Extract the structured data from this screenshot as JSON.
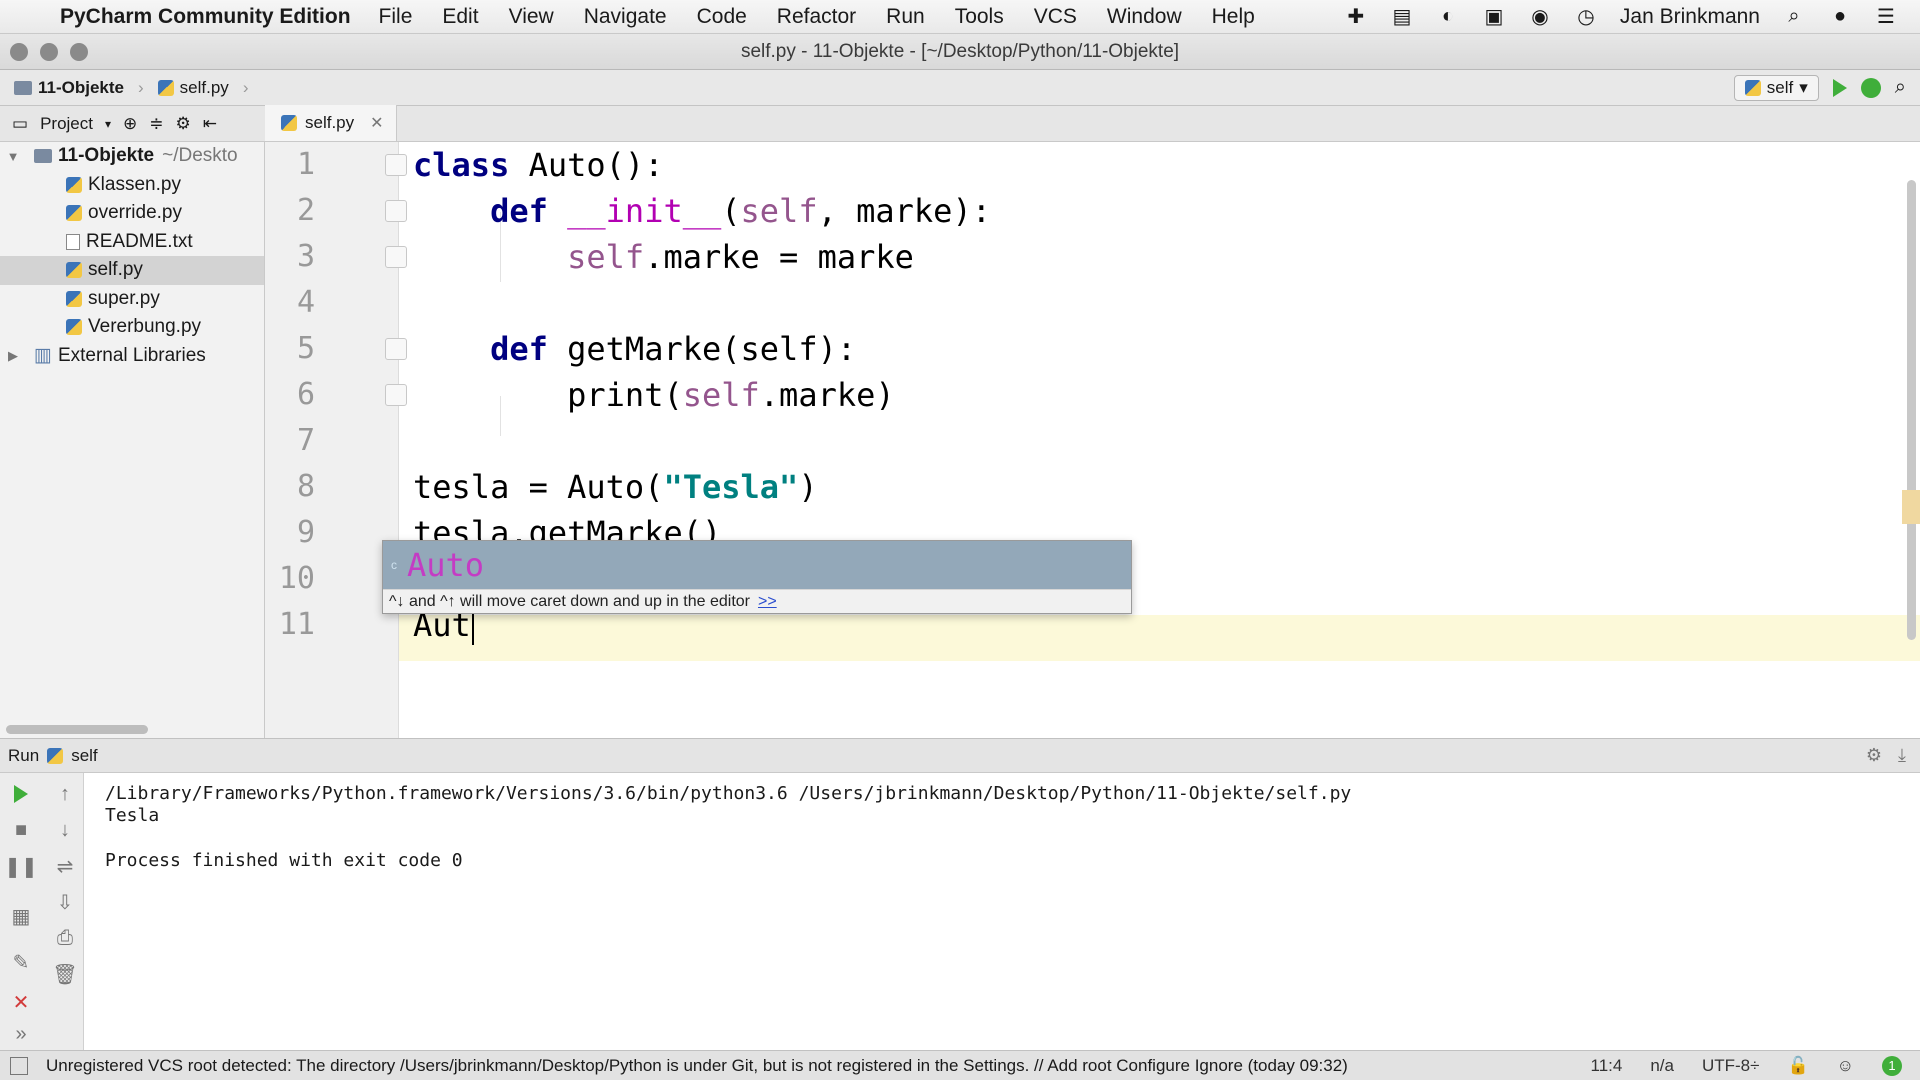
{
  "menubar": {
    "app_name": "PyCharm Community Edition",
    "items": [
      "File",
      "Edit",
      "View",
      "Navigate",
      "Code",
      "Refactor",
      "Run",
      "Tools",
      "VCS",
      "Window",
      "Help"
    ],
    "user": "Jan Brinkmann"
  },
  "window": {
    "title": "self.py - 11-Objekte - [~/Desktop/Python/11-Objekte]"
  },
  "navbar": {
    "crumb_project": "11-Objekte",
    "crumb_file": "self.py",
    "run_config": "self"
  },
  "project_panel": {
    "label": "Project",
    "root": "11-Objekte",
    "root_path": "~/Deskto",
    "files": [
      {
        "name": "Klassen.py",
        "type": "py"
      },
      {
        "name": "override.py",
        "type": "py"
      },
      {
        "name": "README.txt",
        "type": "txt"
      },
      {
        "name": "self.py",
        "type": "py",
        "selected": true
      },
      {
        "name": "super.py",
        "type": "py"
      },
      {
        "name": "Vererbung.py",
        "type": "py"
      }
    ],
    "external": "External Libraries"
  },
  "editor": {
    "tab_label": "self.py",
    "line_numbers": [
      "1",
      "2",
      "3",
      "4",
      "5",
      "6",
      "7",
      "8",
      "9",
      "10",
      "11"
    ],
    "tokens": {
      "l1_kw": "class",
      "l1_rest": " Auto():",
      "l2_kw": "def",
      "l2_magic": "__init__",
      "l2_open": "(",
      "l2_self": "self",
      "l2_rest": ", marke):",
      "l3_self": "self",
      "l3_rest": ".marke = marke",
      "l5_kw": "def",
      "l5_rest": " getMarke(self):",
      "l6_a": "print(",
      "l6_self": "self",
      "l6_b": ".marke)",
      "l8_a": "tesla = Auto(",
      "l8_str": "\"Tesla\"",
      "l8_b": ")",
      "l9": "tesla.getMarke()",
      "l11": "Aut"
    }
  },
  "completion": {
    "kind_icon": "c",
    "item": "Auto",
    "hint": "^↓ and ^↑ will move caret down and up in the editor",
    "hint_link": ">>"
  },
  "run_panel": {
    "label": "Run",
    "config": "self",
    "output": [
      "/Library/Frameworks/Python.framework/Versions/3.6/bin/python3.6 /Users/jbrinkmann/Desktop/Python/11-Objekte/self.py",
      "Tesla",
      "",
      "Process finished with exit code 0"
    ]
  },
  "statusbar": {
    "message": "Unregistered VCS root detected: The directory /Users/jbrinkmann/Desktop/Python is under Git, but is not registered in the Settings. // Add root  Configure  Ignore (today 09:32)",
    "position": "11:4",
    "na": "n/a",
    "encoding": "UTF-8÷",
    "events": "1"
  },
  "colors": {
    "accent_run": "#3fae3a",
    "completion_selected": "#93a8b9",
    "current_line": "#fcf9d9",
    "keyword": "#000080",
    "string": "#008080"
  }
}
